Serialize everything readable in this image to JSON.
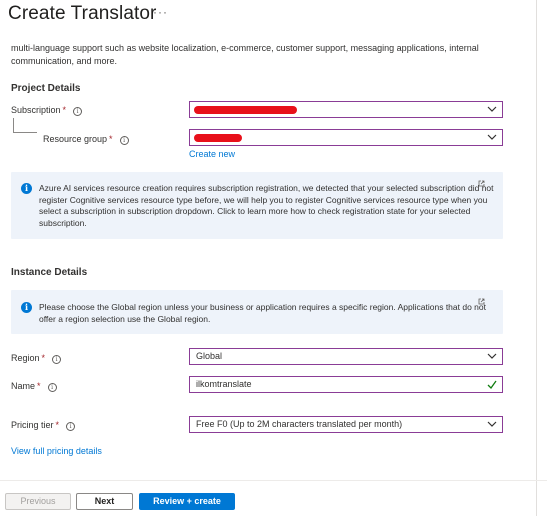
{
  "page": {
    "title": "Create Translator",
    "more_label": "···"
  },
  "description": "multi-language support such as website localization, e-commerce, customer support, messaging applications, internal communication, and more.",
  "project_details": {
    "heading": "Project Details",
    "subscription": {
      "label": "Subscription",
      "required_mark": "*",
      "value": ""
    },
    "resource_group": {
      "label": "Resource group",
      "required_mark": "*",
      "value": ""
    },
    "create_new_link": "Create new"
  },
  "info_subscription": {
    "text": "Azure AI services resource creation requires subscription registration, we detected that your selected subscription did not register Cognitive services resource type before, we will help you to register Cognitive services resource type when you select a subscription in subscription dropdown. Click to learn more how to check registration state for your selected subscription."
  },
  "instance_details": {
    "heading": "Instance Details",
    "info_region": {
      "text": "Please choose the Global region unless your business or application requires a specific region. Applications that do not offer a region selection use the Global region."
    },
    "region": {
      "label": "Region",
      "required_mark": "*",
      "value": "Global"
    },
    "name": {
      "label": "Name",
      "required_mark": "*",
      "value": "ilkomtranslate"
    },
    "pricing_tier": {
      "label": "Pricing tier",
      "required_mark": "*",
      "value": "Free F0 (Up to 2M characters translated per month)"
    },
    "pricing_link": "View full pricing details"
  },
  "footer": {
    "previous_label": "Previous",
    "next_label": "Next",
    "create_label": "Review + create"
  },
  "colors": {
    "accent": "#0078d4",
    "focus_border": "#8a3c96",
    "required": "#a4262c",
    "info_background": "#eef3fa",
    "success_check": "#107c10",
    "redaction": "#e8101a"
  },
  "icons": {
    "info": "info-icon",
    "chevron": "chevron-down-icon",
    "external": "external-link-icon",
    "check": "checkmark-icon"
  }
}
